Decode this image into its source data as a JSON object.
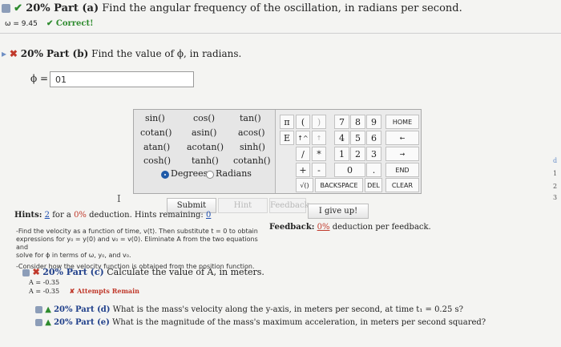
{
  "part_a": {
    "percent_label": "20% Part (a)",
    "question": "Find the angular frequency of the oscillation, in radians per second.",
    "answer": "ω = 9.45",
    "correct_label": "✔ Correct!"
  },
  "part_b": {
    "percent_label": "20% Part (b)",
    "question": "Find the value of ϕ, in radians.",
    "input_label": "ϕ =",
    "input_value": "01"
  },
  "keypad": {
    "functions": [
      "sin()",
      "cos()",
      "tan()",
      "cotan()",
      "asin()",
      "acos()",
      "atan()",
      "acotan()",
      "sinh()",
      "cosh()",
      "tanh()",
      "cotanh()"
    ],
    "degrees_label": "Degrees",
    "radians_label": "Radians",
    "pi": "π",
    "open_paren": "(",
    "close_paren": ")",
    "e_key": "E",
    "up_caret": "↑^",
    "left_arrow_key": "↑",
    "divide": "/",
    "multiply": "*",
    "plus": "+",
    "minus": "-",
    "zero": "0",
    "dot": ".",
    "sqrt": "√()",
    "backspace": "BACKSPACE",
    "del": "DEL",
    "clear": "CLEAR",
    "home": "HOME",
    "end": "END",
    "back_arrow": "←",
    "fwd_arrow": "→",
    "digits": [
      "7",
      "8",
      "9",
      "4",
      "5",
      "6",
      "1",
      "2",
      "3"
    ]
  },
  "buttons": {
    "submit": "Submit",
    "hint": "Hint",
    "feedback": "Feedback",
    "give_up": "I give up!"
  },
  "hints": {
    "prefix": "Hints:",
    "count": "2",
    "text_mid": "for a",
    "pct": "0%",
    "text_end": "deduction. Hints remaining:",
    "remaining": "0",
    "lines": [
      "-Find the velocity as a function of time, v(t). Then substitute t = 0 to obtain",
      "expressions for y₀ = y(0) and v₀ = v(0). Eliminate A from the two equations and",
      "solve for ϕ in terms of ω, y₀, and v₀.",
      "-Consider how the velocity function is obtained from the position function."
    ]
  },
  "feedback": {
    "prefix": "Feedback:",
    "pct": "0%",
    "text": "deduction per feedback."
  },
  "part_c": {
    "percent_label": "20% Part (c)",
    "question": "Calculate the value of A, in meters.",
    "attempt1": "A = -0.35",
    "attempt2": "A = -0.35",
    "attempts_label": "✘ Attempts Remain"
  },
  "part_d": {
    "percent_label": "20% Part (d)",
    "question": "What is the mass's velocity along the y-axis, in meters per second, at time t₁ = 0.25 s?"
  },
  "part_e": {
    "percent_label": "20% Part (e)",
    "question": "What is the magnitude of the mass's maximum acceleration, in meters per second squared?"
  },
  "margin_numbers": [
    "1",
    "2",
    "3"
  ],
  "margin_letter": "d",
  "colors": {
    "correct_green": "#2e8b2e",
    "incorrect_red": "#c0392b",
    "link_blue": "#1e4fb0",
    "part_blue": "#1f3f8a"
  }
}
